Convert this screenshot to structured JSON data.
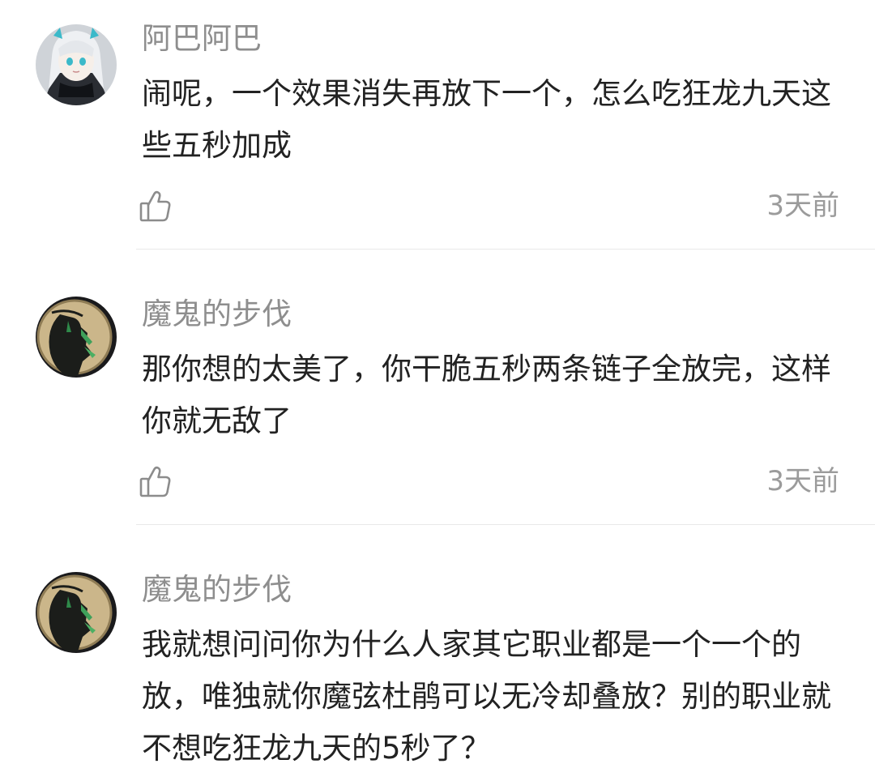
{
  "comments": [
    {
      "username": "阿巴阿巴",
      "text": "闹呢，一个效果消失再放下一个，怎么吃狂龙九天这些五秒加成",
      "time": "3天前",
      "avatar_icon": "anime-girl-avatar",
      "like_icon": "thumbs-up-icon"
    },
    {
      "username": "魔鬼的步伐",
      "text": "那你想的太美了，你干脆五秒两条链子全放完，这样你就无敌了",
      "time": "3天前",
      "avatar_icon": "reaper-moon-avatar",
      "like_icon": "thumbs-up-icon"
    },
    {
      "username": "魔鬼的步伐",
      "text": "我就想问问你为什么人家其它职业都是一个一个的放，唯独就你魔弦杜鹃可以无冷却叠放？别的职业就不想吃狂龙九天的5秒了？",
      "avatar_icon": "reaper-moon-avatar"
    }
  ],
  "colors": {
    "username": "#8e8e8e",
    "text": "#222222",
    "time": "#9b9b9b",
    "divider": "#e9e9e9"
  }
}
